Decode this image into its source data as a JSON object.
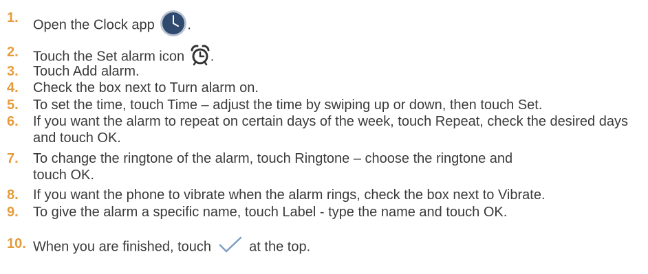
{
  "steps": [
    {
      "num": "1.",
      "text_before": "Open the Clock app",
      "icon": "clock-app-icon",
      "text_after": "."
    },
    {
      "num": "2.",
      "text_before": "Touch the Set alarm icon",
      "icon": "alarm-clock-icon",
      "text_after": "."
    },
    {
      "num": "3.",
      "text": "Touch Add alarm."
    },
    {
      "num": "4.",
      "text": "Check the box next to Turn alarm on."
    },
    {
      "num": "5.",
      "text": "To set the time, touch Time – adjust the time by swiping up or down, then touch Set."
    },
    {
      "num": "6.",
      "text": "If you want the alarm to repeat on certain days of the week, touch Repeat, check the desired days and touch OK."
    },
    {
      "num": "7.",
      "text": "To change the ringtone of the alarm, touch Ringtone – choose the ringtone and touch OK."
    },
    {
      "num": "8.",
      "text": "If you want the phone to vibrate when the alarm rings, check the box next to Vibrate."
    },
    {
      "num": "9.",
      "text": "To give the alarm a specific name, touch Label - type the name and touch OK."
    },
    {
      "num": "10.",
      "text_before": "When you are finished, touch",
      "icon": "checkmark-icon",
      "text_after": "at the top."
    }
  ],
  "colors": {
    "number": "#e59b3a",
    "text": "#3a3a3a",
    "clock_face": "#2f4a6e",
    "icon_dark": "#333333",
    "checkmark": "#7a9fc4"
  }
}
